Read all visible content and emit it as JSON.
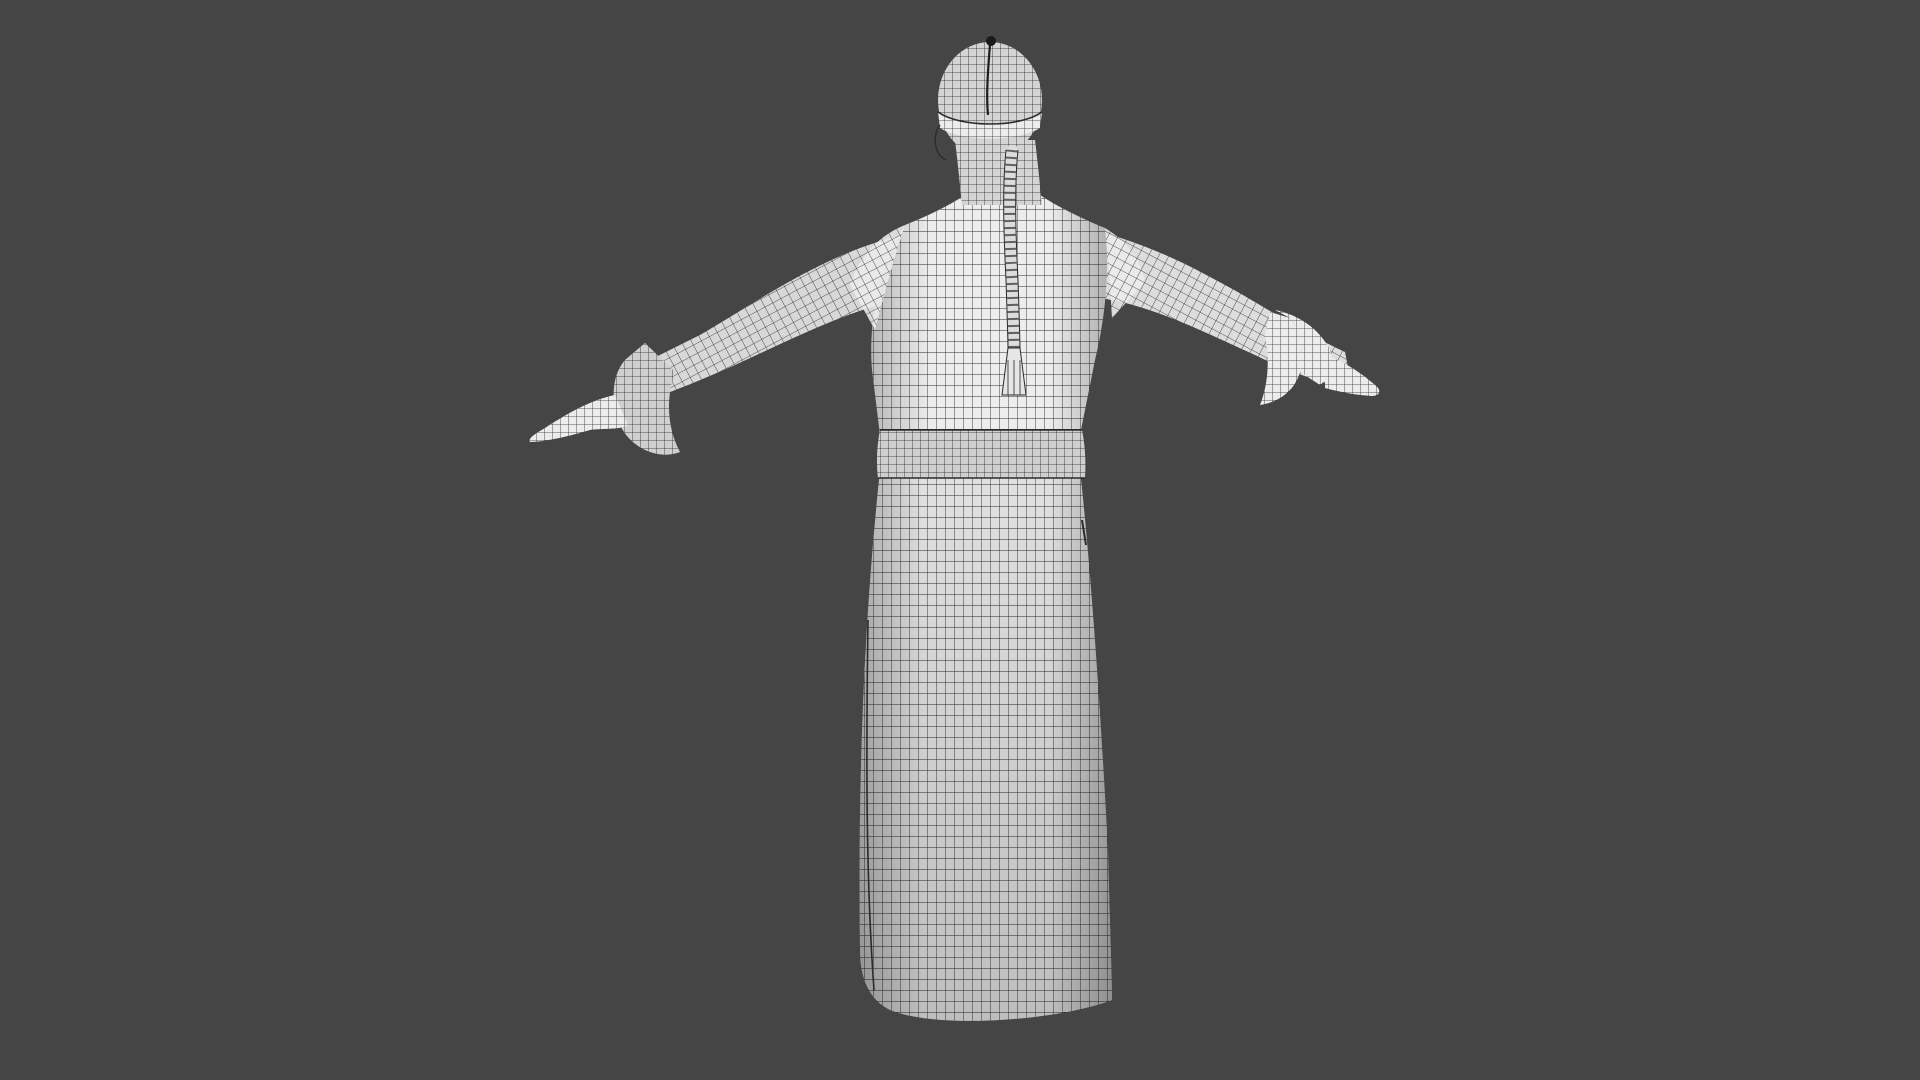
{
  "viewport": {
    "background_color": "#454545",
    "mesh_color": "#eeeeee",
    "wire_color": "#2a2a2a",
    "subject": "t-pose-robed-figure-wireframe",
    "view": "back"
  }
}
